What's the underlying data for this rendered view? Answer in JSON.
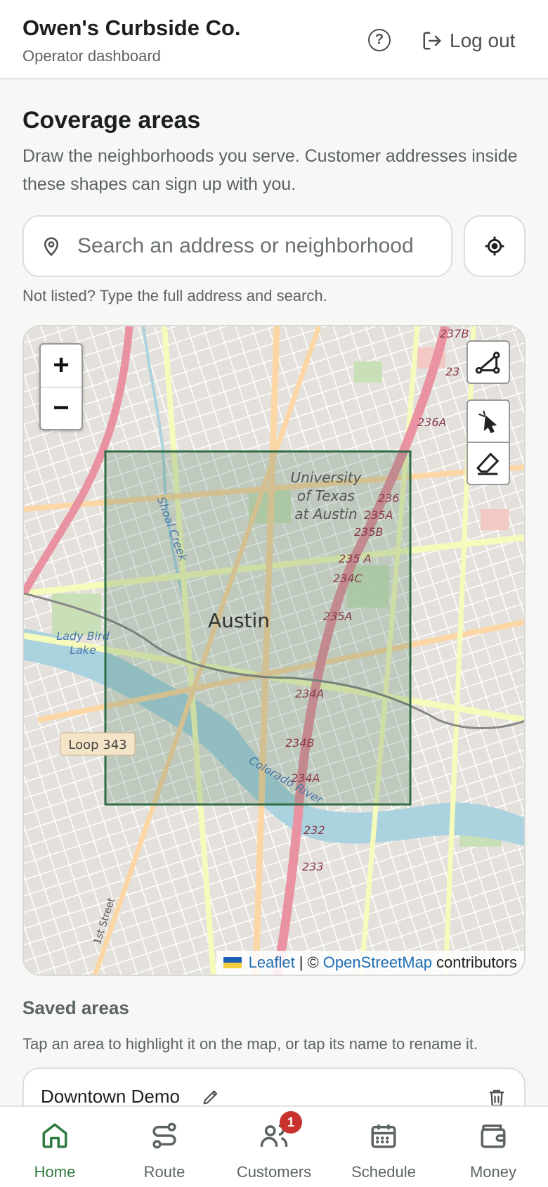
{
  "header": {
    "brand": "Owen's Curbside Co.",
    "subtitle": "Operator dashboard",
    "help_symbol": "?",
    "logout_label": "Log out"
  },
  "coverage": {
    "title": "Coverage areas",
    "description": "Draw the neighborhoods you serve. Customer addresses inside these shapes can sign up with you.",
    "search_placeholder": "Search an address or neighborhood",
    "search_value": "",
    "hint": "Not listed? Type the full address and search."
  },
  "map": {
    "zoom_in": "+",
    "zoom_out": "−",
    "labels": {
      "city": "Austin",
      "university_1": "University",
      "university_2": "of Texas",
      "university_3": "at Austin",
      "creek": "Shoal Creek",
      "lake_1": "Lady Bird",
      "lake_2": "Lake",
      "river": "Colorado River",
      "loop": "Loop 343",
      "street": "1st Street",
      "exits": [
        "237B",
        "236A",
        "236",
        "235A",
        "235B",
        "235 A",
        "234C",
        "235A",
        "234A",
        "234B",
        "234A",
        "232",
        "233",
        "23"
      ]
    },
    "attribution": {
      "leaflet": "Leaflet",
      "separator": "| ©",
      "osm": "OpenStreetMap",
      "suffix": "contributors"
    },
    "area_color": "#2f6b45"
  },
  "saved": {
    "title": "Saved areas",
    "description": "Tap an area to highlight it on the map, or tap its name to rename it.",
    "areas": [
      {
        "name": "Downtown Demo"
      }
    ]
  },
  "nav": {
    "items": [
      {
        "label": "Home",
        "icon": "home-icon",
        "active": true
      },
      {
        "label": "Route",
        "icon": "route-icon"
      },
      {
        "label": "Customers",
        "icon": "customers-icon",
        "badge": "1"
      },
      {
        "label": "Schedule",
        "icon": "calendar-icon"
      },
      {
        "label": "Money",
        "icon": "wallet-icon"
      }
    ]
  },
  "colors": {
    "accent": "#2f7a3e",
    "badge": "#c8342d",
    "highway": "#d9667a",
    "water": "#aad3df"
  }
}
